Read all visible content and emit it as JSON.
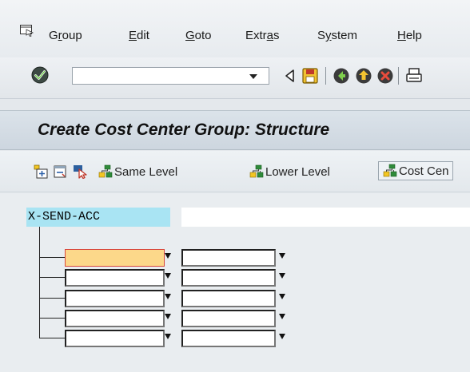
{
  "menu": {
    "items": [
      {
        "pre": "G",
        "u": "r",
        "post": "oup"
      },
      {
        "pre": "",
        "u": "E",
        "post": "dit"
      },
      {
        "pre": "",
        "u": "G",
        "post": "oto"
      },
      {
        "pre": "Extr",
        "u": "a",
        "post": "s"
      },
      {
        "pre": "S",
        "u": "y",
        "post": "stem"
      },
      {
        "pre": "",
        "u": "H",
        "post": "elp"
      }
    ]
  },
  "toolbar": {
    "command_field_value": "",
    "icons": [
      "ok-check-icon",
      "back-triangle-icon",
      "save-floppy-icon",
      "back-green-icon",
      "exit-yellow-icon",
      "cancel-red-icon",
      "print-icon"
    ]
  },
  "title": "Create Cost Center Group: Structure",
  "app_toolbar": {
    "same_level": "Same Level",
    "lower_level": "Lower Level",
    "cost_center": "Cost Cen"
  },
  "tree": {
    "root_node": "X-SEND-ACC",
    "root_description": "",
    "children": [
      {
        "value": "",
        "description": "",
        "active": true
      },
      {
        "value": "",
        "description": "",
        "active": false
      },
      {
        "value": "",
        "description": "",
        "active": false
      },
      {
        "value": "",
        "description": "",
        "active": false
      },
      {
        "value": "",
        "description": "",
        "active": false
      }
    ]
  },
  "colors": {
    "title_bar": "#cdd6df",
    "root_highlight": "#a9e4f3",
    "active_field": "#fcd88a",
    "active_border": "#d8473c"
  }
}
